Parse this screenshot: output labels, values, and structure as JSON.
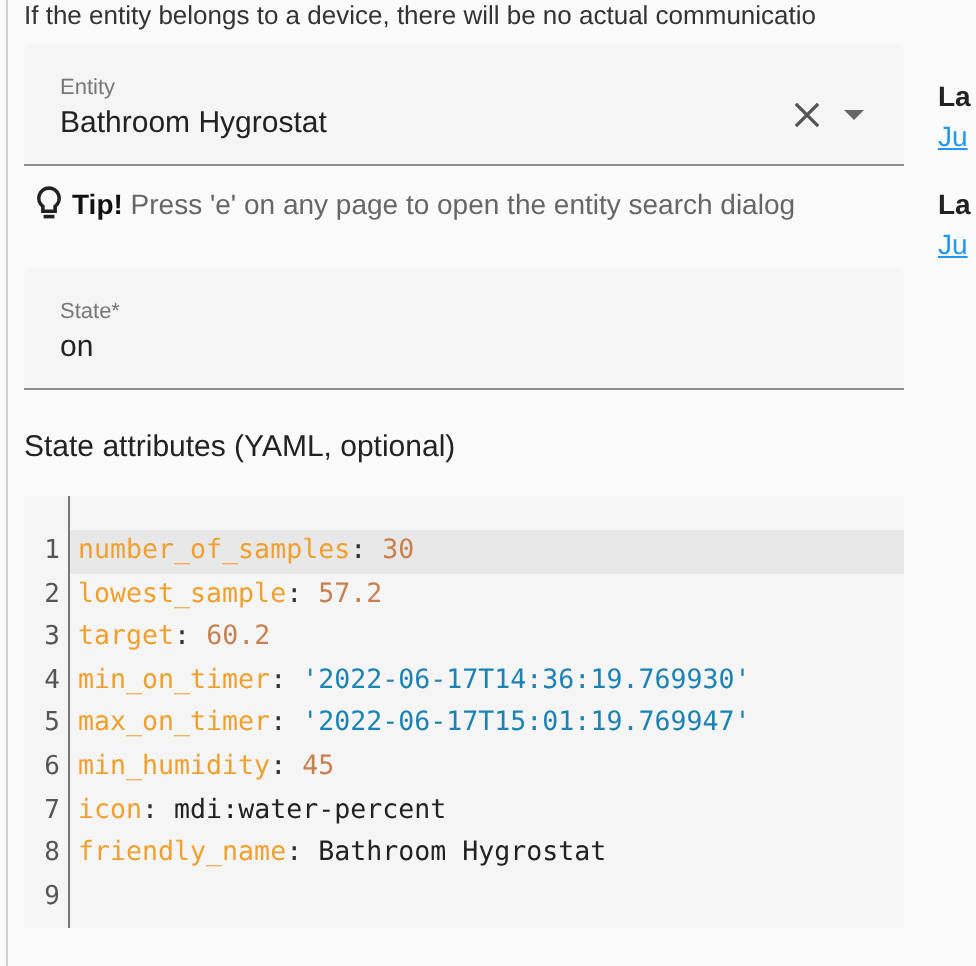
{
  "intro_text": "If the entity belongs to a device, there will be no actual communicatio",
  "entity_field": {
    "label": "Entity",
    "value": "Bathroom Hygrostat"
  },
  "tip": "**Tip!** Press 'e' on any page to open the entity search dialog",
  "state_field": {
    "label": "State*",
    "value": "on"
  },
  "attributes_label": "State attributes (YAML, optional)",
  "editor_lines": [
    {
      "number": "1",
      "selected": true,
      "tokens": [
        {
          "kind": "key",
          "text": "number_of_samples"
        },
        {
          "kind": "punct",
          "text": ": "
        },
        {
          "kind": "number",
          "text": "30"
        }
      ]
    },
    {
      "number": "2",
      "selected": false,
      "tokens": [
        {
          "kind": "key",
          "text": "lowest_sample"
        },
        {
          "kind": "punct",
          "text": ": "
        },
        {
          "kind": "number",
          "text": "57.2"
        }
      ]
    },
    {
      "number": "3",
      "selected": false,
      "tokens": [
        {
          "kind": "key",
          "text": "target"
        },
        {
          "kind": "punct",
          "text": ": "
        },
        {
          "kind": "number",
          "text": "60.2"
        }
      ]
    },
    {
      "number": "4",
      "selected": false,
      "tokens": [
        {
          "kind": "key",
          "text": "min_on_timer"
        },
        {
          "kind": "punct",
          "text": ": "
        },
        {
          "kind": "string",
          "text": "'2022-06-17T14:36:19.769930'"
        }
      ]
    },
    {
      "number": "5",
      "selected": false,
      "tokens": [
        {
          "kind": "key",
          "text": "max_on_timer"
        },
        {
          "kind": "punct",
          "text": ": "
        },
        {
          "kind": "string",
          "text": "'2022-06-17T15:01:19.769947'"
        }
      ]
    },
    {
      "number": "6",
      "selected": false,
      "tokens": [
        {
          "kind": "key",
          "text": "min_humidity"
        },
        {
          "kind": "punct",
          "text": ": "
        },
        {
          "kind": "number",
          "text": "45"
        }
      ]
    },
    {
      "number": "7",
      "selected": false,
      "tokens": [
        {
          "kind": "key",
          "text": "icon"
        },
        {
          "kind": "punct",
          "text": ": "
        },
        {
          "kind": "plain",
          "text": "mdi:water-percent"
        }
      ]
    },
    {
      "number": "8",
      "selected": false,
      "tokens": [
        {
          "kind": "key",
          "text": "friendly_name"
        },
        {
          "kind": "punct",
          "text": ": "
        },
        {
          "kind": "plain",
          "text": "Bathroom Hygrostat"
        }
      ]
    },
    {
      "number": "9",
      "selected": false
    }
  ],
  "side_items": [
    {
      "heading": "La",
      "link": "Ju"
    },
    {
      "heading": "La",
      "link": "Ju"
    }
  ]
}
